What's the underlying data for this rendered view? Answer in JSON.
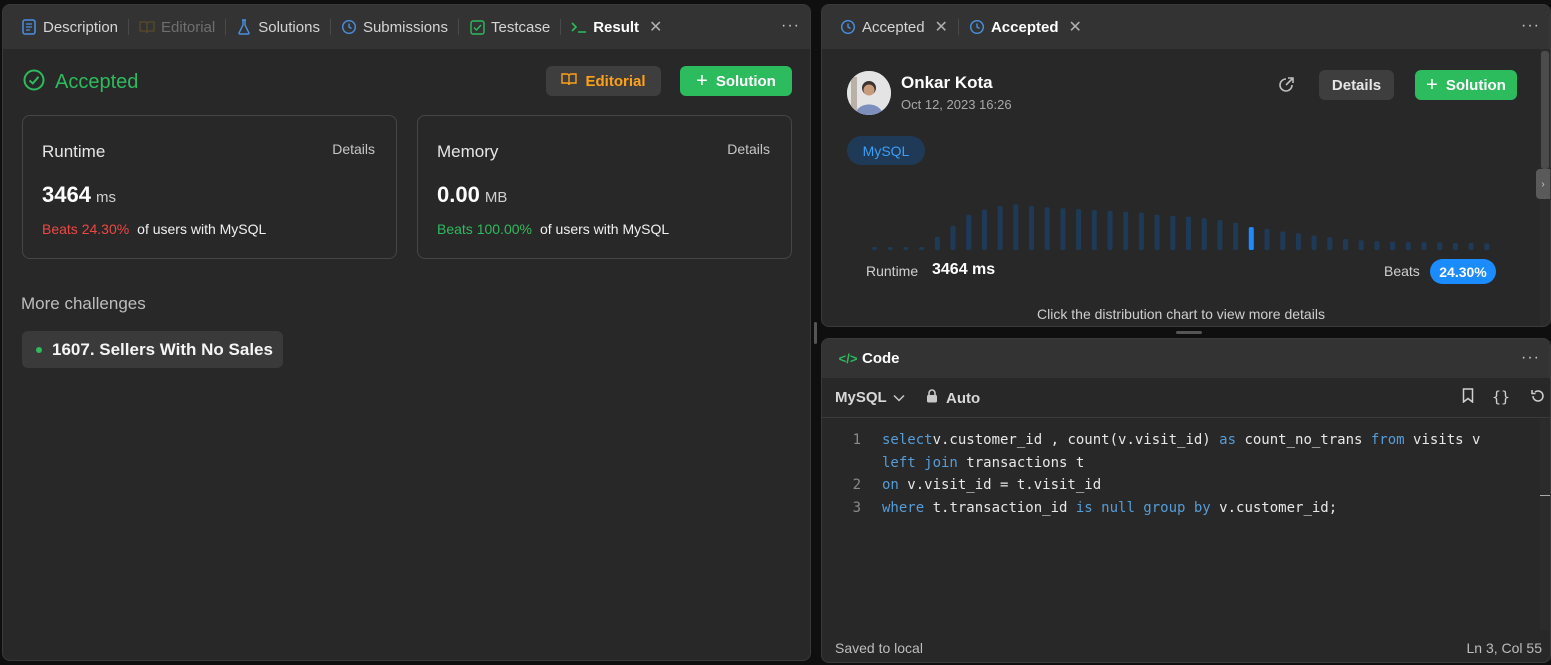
{
  "left_panel": {
    "tabs": [
      {
        "label": "Description",
        "icon": "description-icon"
      },
      {
        "label": "Editorial",
        "icon": "book-icon"
      },
      {
        "label": "Solutions",
        "icon": "flask-icon"
      },
      {
        "label": "Submissions",
        "icon": "history-icon"
      },
      {
        "label": "Testcase",
        "icon": "checkbox-icon"
      },
      {
        "label": "Result",
        "icon": "terminal-icon"
      }
    ],
    "status": "Accepted",
    "editorial_btn": "Editorial",
    "solution_btn": "Solution",
    "runtime": {
      "label": "Runtime",
      "details": "Details",
      "value": "3464",
      "unit": "ms",
      "beats": "Beats 24.30%",
      "suffix": "of users with MySQL"
    },
    "memory": {
      "label": "Memory",
      "details": "Details",
      "value": "0.00",
      "unit": "MB",
      "beats": "Beats 100.00%",
      "suffix": "of users with MySQL"
    },
    "more_challenges": "More challenges",
    "challenge": "1607. Sellers With No Sales"
  },
  "right_top": {
    "tabs": [
      {
        "label": "Accepted",
        "icon": "history-icon"
      },
      {
        "label": "Accepted",
        "icon": "history-icon"
      }
    ],
    "user_name": "Onkar Kota",
    "date": "Oct 12, 2023 16:26",
    "details_btn": "Details",
    "solution_btn": "Solution",
    "language": "MySQL",
    "runtime_label": "Runtime",
    "runtime_value": "3464 ms",
    "beats_label": "Beats",
    "beats_value": "24.30%",
    "hint": "Click the distribution chart to view more details",
    "distribution": {
      "values": [
        0.06,
        0.06,
        0.06,
        0.06,
        0.3,
        0.55,
        0.8,
        0.92,
        1.0,
        1.04,
        1.0,
        0.97,
        0.95,
        0.93,
        0.91,
        0.89,
        0.87,
        0.85,
        0.8,
        0.78,
        0.76,
        0.72,
        0.68,
        0.62,
        0.52,
        0.48,
        0.42,
        0.38,
        0.33,
        0.29,
        0.25,
        0.22,
        0.2,
        0.19,
        0.18,
        0.18,
        0.17,
        0.16,
        0.16,
        0.15
      ],
      "highlight_index": 24,
      "bar_color": "#1f3a57",
      "highlight_color": "#1a8cff"
    }
  },
  "right_bottom": {
    "tab": "Code",
    "language": "MySQL",
    "mode": "Auto",
    "code_lines": [
      {
        "num": "1",
        "tokens": [
          [
            "kw",
            "select"
          ],
          [
            "",
            "v.customer_id , count(v.visit_id) "
          ],
          [
            "kw",
            "as"
          ],
          [
            "",
            " count_no_trans "
          ],
          [
            "kw",
            "from"
          ],
          [
            "",
            " visits v"
          ]
        ]
      },
      {
        "num": "",
        "tokens": [
          [
            "kw",
            "left join"
          ],
          [
            "",
            " transactions t"
          ]
        ]
      },
      {
        "num": "2",
        "tokens": [
          [
            "kw",
            "on"
          ],
          [
            "",
            " v.visit_id = t.visit_id"
          ]
        ]
      },
      {
        "num": "3",
        "tokens": [
          [
            "kw",
            "where"
          ],
          [
            "",
            " t.transaction_id "
          ],
          [
            "kw",
            "is null group by"
          ],
          [
            "",
            " v.customer_id;"
          ]
        ]
      }
    ],
    "status_left": "Saved to local",
    "status_right": "Ln 3, Col 55"
  },
  "colors": {
    "accent_green": "#2cbb5d",
    "accent_orange": "#ffa116",
    "beats_red": "#ef4743",
    "keyword_blue": "#569cd6"
  }
}
